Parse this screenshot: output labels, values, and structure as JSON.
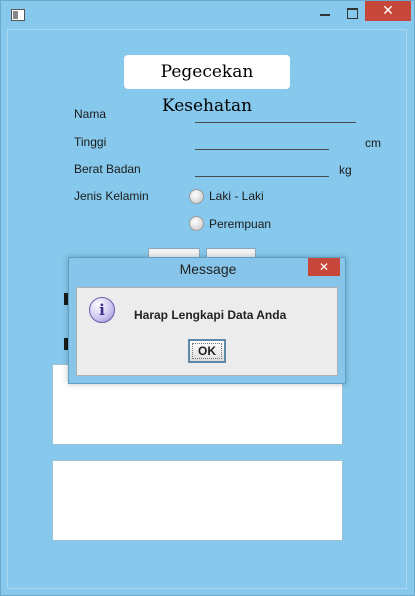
{
  "window": {
    "title": ""
  },
  "form": {
    "title": "Pegecekan Kesehatan",
    "fields": [
      {
        "label": "Nama",
        "unit": ""
      },
      {
        "label": "Tinggi",
        "unit": "cm"
      },
      {
        "label": "Berat Badan",
        "unit": "kg"
      }
    ],
    "gender": {
      "label": "Jenis Kelamin",
      "options": [
        "Laki - Laki",
        "Perempuan"
      ]
    }
  },
  "dialog": {
    "title": "Message",
    "message": "Harap Lengkapi Data Anda",
    "ok_label": "OK",
    "icon": "info-icon",
    "close_symbol": "✕"
  },
  "colors": {
    "background": "#86c9ec",
    "close_button": "#c7473b"
  }
}
